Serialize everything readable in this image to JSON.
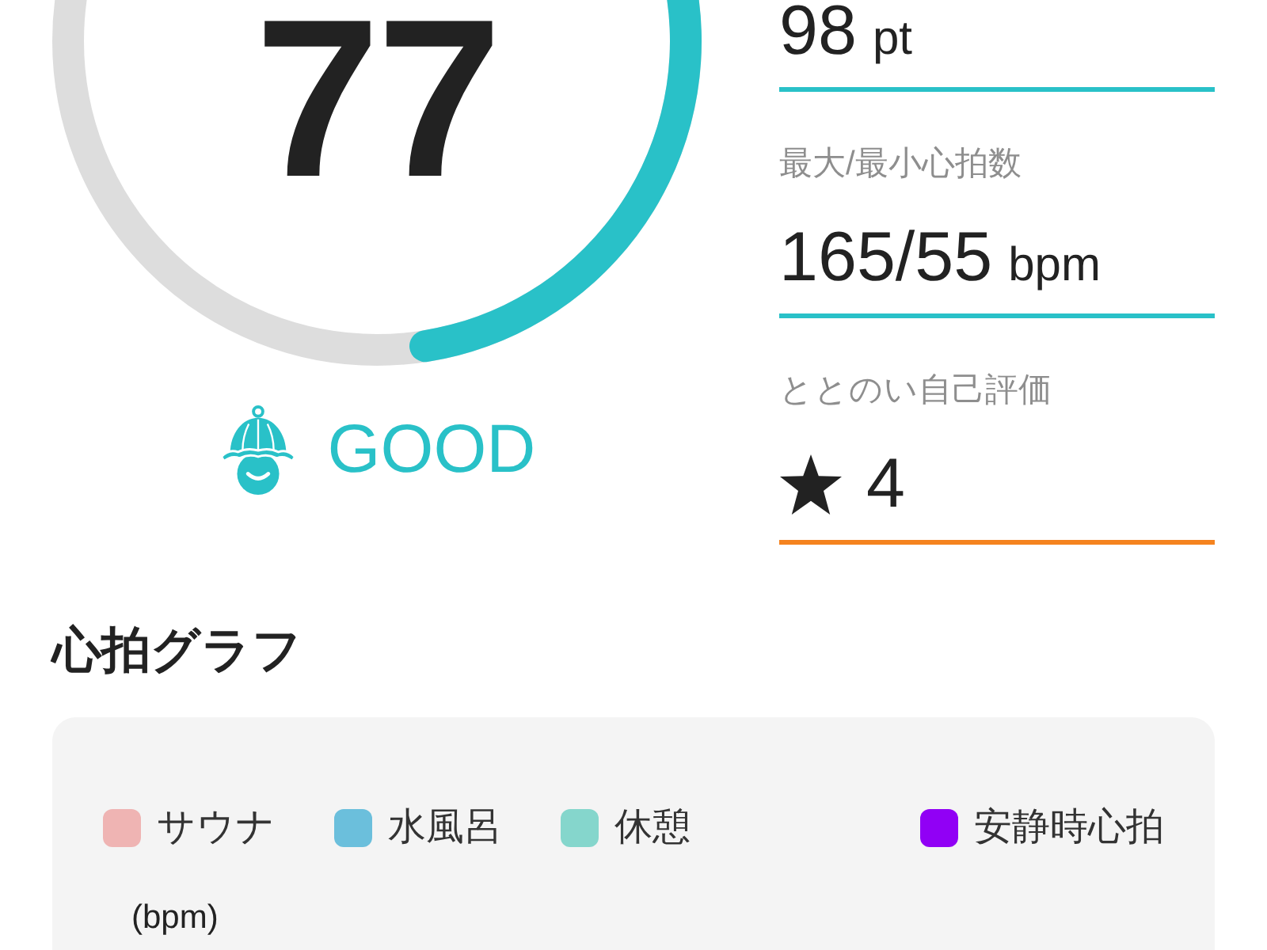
{
  "score": {
    "value": "77",
    "level": 0.475,
    "status": "GOOD"
  },
  "metrics": [
    {
      "kind": "value",
      "value": "98",
      "unit": "pt",
      "color": "#29c1c8"
    },
    {
      "kind": "value",
      "label": "最大/最小心拍数",
      "value": "165/55",
      "unit": "bpm",
      "color": "#29c1c8"
    },
    {
      "kind": "rating",
      "label": "ととのい自己評価",
      "value": "4",
      "color": "#f5831f"
    }
  ],
  "heart_rate_graph": {
    "title": "心拍グラフ",
    "legend": [
      {
        "label": "サウナ",
        "color": "#efb4b3"
      },
      {
        "label": "水風呂",
        "color": "#6bbfdc"
      },
      {
        "label": "休憩",
        "color": "#85d6cc"
      },
      {
        "label": "安静時心拍",
        "color": "#9100f5"
      }
    ],
    "y_unit": "(bpm)"
  }
}
